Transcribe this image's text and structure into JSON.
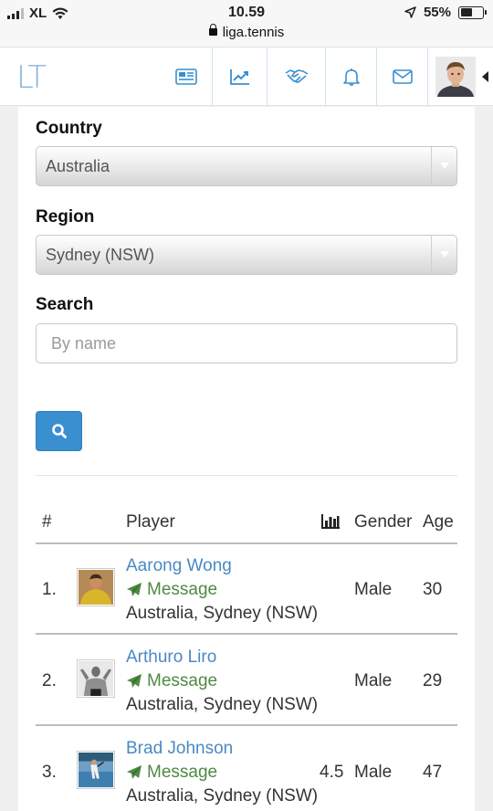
{
  "status_bar": {
    "carrier": "XL",
    "time": "10.59",
    "url": "liga.tennis",
    "battery": "55%",
    "battery_level": 0.55
  },
  "nav": {
    "logo": "LT",
    "icons": [
      "newspaper-icon",
      "chart-line-icon",
      "handshake-icon",
      "bell-icon",
      "envelope-icon"
    ]
  },
  "filters": {
    "country_label": "Country",
    "country_value": "Australia",
    "region_label": "Region",
    "region_value": "Sydney (NSW)",
    "search_label": "Search",
    "search_placeholder": "By name"
  },
  "table": {
    "headers": {
      "rank": "#",
      "player": "Player",
      "gender": "Gender",
      "age": "Age"
    },
    "rows": [
      {
        "rank": "1.",
        "name": "Aarong Wong",
        "message": "Message",
        "location": "Australia, Sydney (NSW)",
        "rating": "",
        "gender": "Male",
        "age": "30"
      },
      {
        "rank": "2.",
        "name": "Arthuro Liro",
        "message": "Message",
        "location": "Australia, Sydney (NSW)",
        "rating": "",
        "gender": "Male",
        "age": "29"
      },
      {
        "rank": "3.",
        "name": "Brad Johnson",
        "message": "Message",
        "location": "Australia, Sydney (NSW)",
        "rating": "4.5",
        "gender": "Male",
        "age": "47"
      }
    ]
  },
  "colors": {
    "accent": "#3a8fd1",
    "link": "#4a89c4",
    "message": "#4e8a43"
  }
}
